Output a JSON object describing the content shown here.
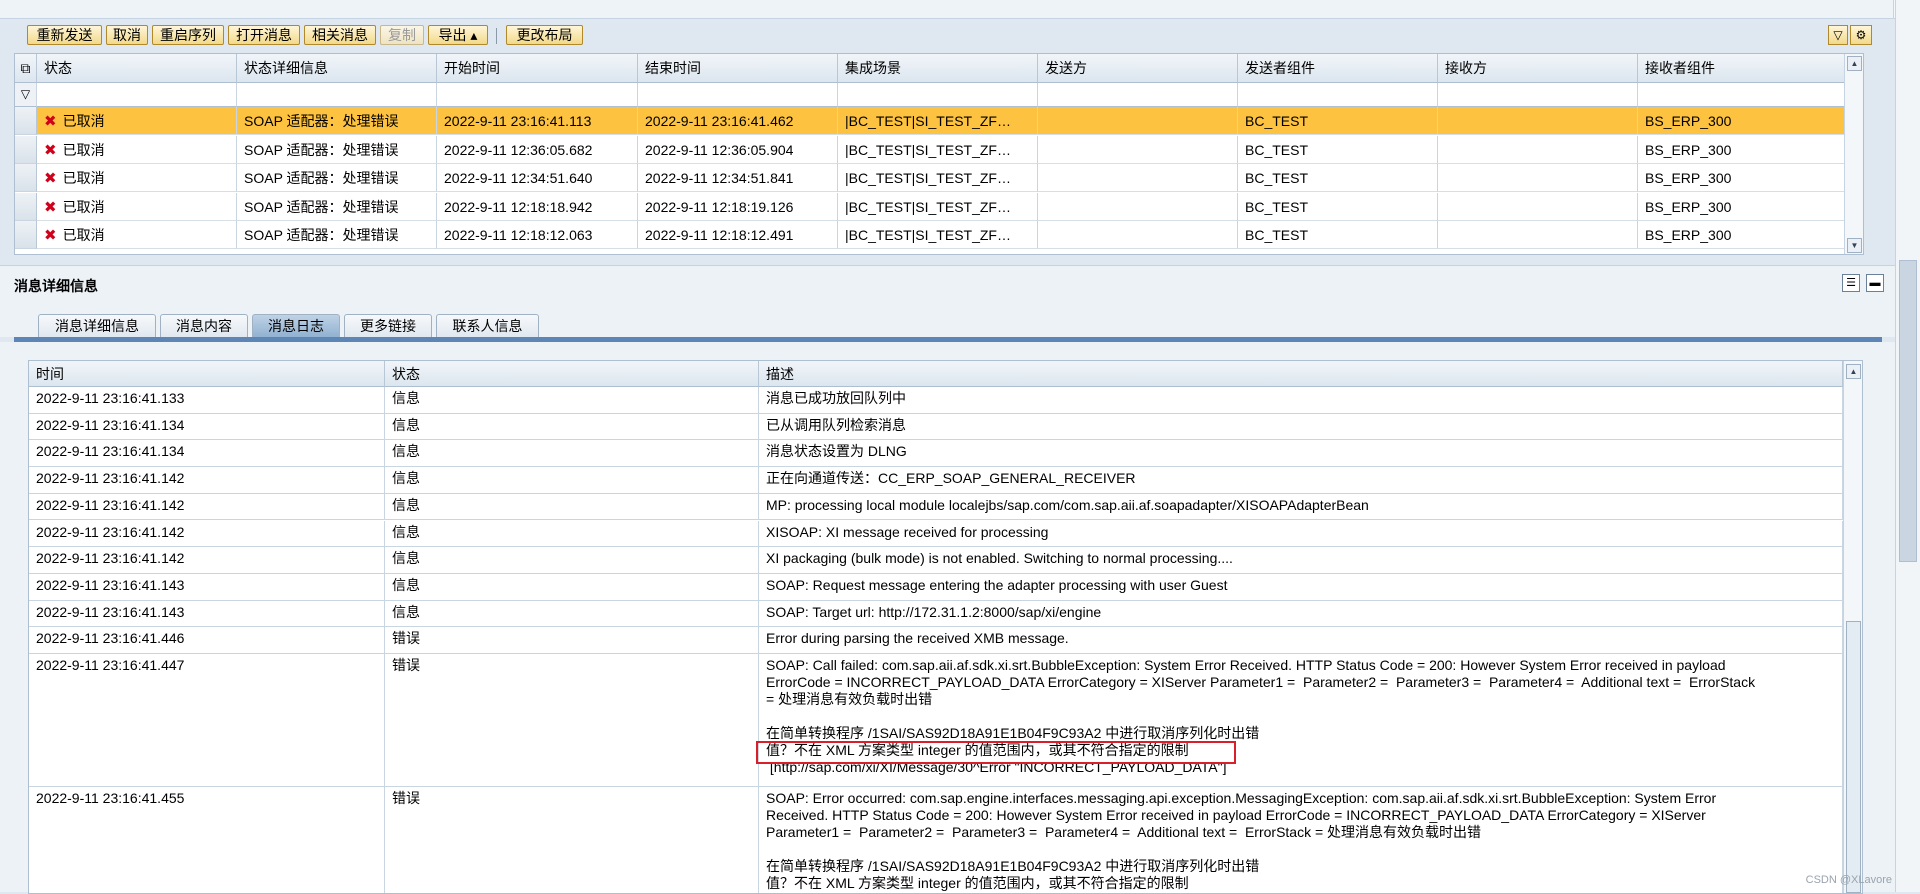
{
  "toolbar": {
    "buttons": [
      "重新发送",
      "取消",
      "重启序列",
      "打开消息",
      "相关消息",
      "复制",
      "导出 ▴",
      "更改布局"
    ]
  },
  "grid": {
    "headers": [
      "状态",
      "状态详细信息",
      "开始时间",
      "结束时间",
      "集成场景",
      "发送方",
      "发送者组件",
      "接收方",
      "接收者组件"
    ],
    "rows": [
      {
        "status": "已取消",
        "detail": "SOAP 适配器：处理错误",
        "start": "2022-9-11 23:16:41.113",
        "end": "2022-9-11 23:16:41.462",
        "scenario": "|BC_TEST|SI_TEST_ZF…",
        "sender": "",
        "sender_comp": "BC_TEST",
        "receiver": "",
        "receiver_comp": "BS_ERP_300",
        "selected": true
      },
      {
        "status": "已取消",
        "detail": "SOAP 适配器：处理错误",
        "start": "2022-9-11 12:36:05.682",
        "end": "2022-9-11 12:36:05.904",
        "scenario": "|BC_TEST|SI_TEST_ZF…",
        "sender": "",
        "sender_comp": "BC_TEST",
        "receiver": "",
        "receiver_comp": "BS_ERP_300",
        "selected": false
      },
      {
        "status": "已取消",
        "detail": "SOAP 适配器：处理错误",
        "start": "2022-9-11 12:34:51.640",
        "end": "2022-9-11 12:34:51.841",
        "scenario": "|BC_TEST|SI_TEST_ZF…",
        "sender": "",
        "sender_comp": "BC_TEST",
        "receiver": "",
        "receiver_comp": "BS_ERP_300",
        "selected": false
      },
      {
        "status": "已取消",
        "detail": "SOAP 适配器：处理错误",
        "start": "2022-9-11 12:18:18.942",
        "end": "2022-9-11 12:18:19.126",
        "scenario": "|BC_TEST|SI_TEST_ZF…",
        "sender": "",
        "sender_comp": "BC_TEST",
        "receiver": "",
        "receiver_comp": "BS_ERP_300",
        "selected": false
      },
      {
        "status": "已取消",
        "detail": "SOAP 适配器：处理错误",
        "start": "2022-9-11 12:18:12.063",
        "end": "2022-9-11 12:18:12.491",
        "scenario": "|BC_TEST|SI_TEST_ZF…",
        "sender": "",
        "sender_comp": "BC_TEST",
        "receiver": "",
        "receiver_comp": "BS_ERP_300",
        "selected": false
      }
    ]
  },
  "details": {
    "title": "消息详细信息",
    "tabs": [
      "消息详细信息",
      "消息内容",
      "消息日志",
      "更多链接",
      "联系人信息"
    ],
    "active_tab": "消息日志"
  },
  "log": {
    "headers": [
      "时间",
      "状态",
      "描述"
    ],
    "rows": [
      {
        "time": "2022-9-11 23:16:41.133",
        "status": "信息",
        "desc": [
          "消息已成功放回队列中"
        ]
      },
      {
        "time": "2022-9-11 23:16:41.134",
        "status": "信息",
        "desc": [
          "已从调用队列检索消息"
        ]
      },
      {
        "time": "2022-9-11 23:16:41.134",
        "status": "信息",
        "desc": [
          "消息状态设置为 DLNG"
        ]
      },
      {
        "time": "2022-9-11 23:16:41.142",
        "status": "信息",
        "desc": [
          "正在向通道传送：CC_ERP_SOAP_GENERAL_RECEIVER"
        ]
      },
      {
        "time": "2022-9-11 23:16:41.142",
        "status": "信息",
        "desc": [
          "MP: processing local module localejbs/sap.com/com.sap.aii.af.soapadapter/XISOAPAdapterBean"
        ]
      },
      {
        "time": "2022-9-11 23:16:41.142",
        "status": "信息",
        "desc": [
          "XISOAP: XI message received for processing"
        ]
      },
      {
        "time": "2022-9-11 23:16:41.142",
        "status": "信息",
        "desc": [
          "XI packaging (bulk mode) is not enabled. Switching to normal processing...."
        ]
      },
      {
        "time": "2022-9-11 23:16:41.143",
        "status": "信息",
        "desc": [
          "SOAP: Request message entering the adapter processing with user Guest"
        ]
      },
      {
        "time": "2022-9-11 23:16:41.143",
        "status": "信息",
        "desc": [
          "SOAP: Target url: http://172.31.1.2:8000/sap/xi/engine"
        ]
      },
      {
        "time": "2022-9-11 23:16:41.446",
        "status": "错误",
        "desc": [
          "Error during parsing the received XMB message."
        ]
      },
      {
        "time": "2022-9-11 23:16:41.447",
        "status": "错误",
        "desc": [
          "SOAP: Call failed: com.sap.aii.af.sdk.xi.srt.BubbleException: System Error Received. HTTP Status Code = 200: However System Error received in payload",
          "ErrorCode = INCORRECT_PAYLOAD_DATA ErrorCategory = XIServer Parameter1 =  Parameter2 =  Parameter3 =  Parameter4 =  Additional text =  ErrorStack",
          "= 处理消息有效负载时出错",
          "",
          "在简单转换程序 /1SAI/SAS92D18A91E1B04F9C93A2 中进行取消序列化时出错",
          "值？不在 XML 方案类型 integer 的值范围内，或其不符合指定的限制",
          " [http://sap.com/xi/XI/Message/30^Error \"INCORRECT_PAYLOAD_DATA\"]"
        ]
      },
      {
        "time": "2022-9-11 23:16:41.455",
        "status": "错误",
        "desc": [
          "SOAP: Error occurred: com.sap.engine.interfaces.messaging.api.exception.MessagingException: com.sap.aii.af.sdk.xi.srt.BubbleException: System Error",
          "Received. HTTP Status Code = 200: However System Error received in payload ErrorCode = INCORRECT_PAYLOAD_DATA ErrorCategory = XIServer",
          "Parameter1 =  Parameter2 =  Parameter3 =  Parameter4 =  Additional text =  ErrorStack = 处理消息有效负载时出错",
          "",
          "在简单转换程序 /1SAI/SAS92D18A91E1B04F9C93A2 中进行取消序列化时出错",
          "值？不在 XML 方案类型 integer 的值范围内，或其不符合指定的限制"
        ]
      }
    ]
  },
  "watermark": "CSDN @XLavore"
}
